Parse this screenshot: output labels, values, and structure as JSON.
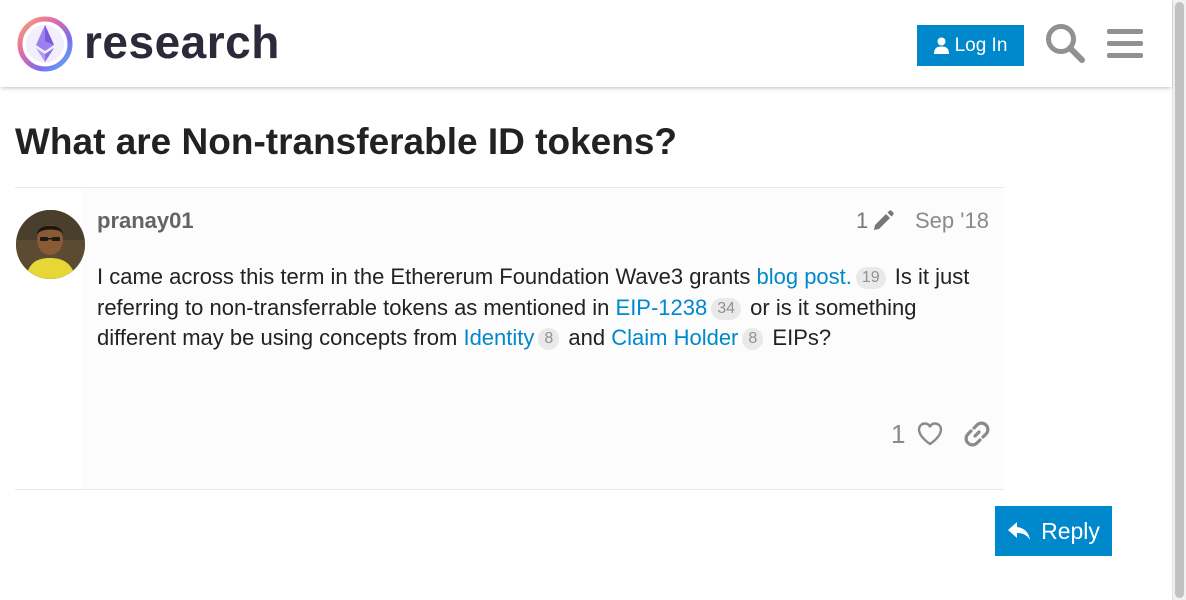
{
  "header": {
    "site_name": "research",
    "logo_icon": "ethereum-research-logo",
    "login_label": "Log In",
    "login_icon": "user-icon",
    "search_icon": "search-icon",
    "menu_icon": "hamburger-menu-icon"
  },
  "topic": {
    "title": "What are Non-transferable ID tokens?"
  },
  "post": {
    "username": "pranay01",
    "edit_count": "1",
    "date": "Sep '18",
    "segments": {
      "t1": "I came across this term in the Ethererum Foundation Wave3 grants ",
      "link1": "blog post.",
      "badge1": "19",
      "t2": " Is it just referring to non-transferrable tokens as mentioned in ",
      "link2": "EIP-1238",
      "badge2": "34",
      "t3": " or is it something different may be using concepts from ",
      "link3": "Identity",
      "badge3": "8",
      "t4": " and ",
      "link4": "Claim Holder",
      "badge4": "8",
      "t5": " EIPs?"
    },
    "like_count": "1"
  },
  "actions": {
    "reply_label": "Reply"
  },
  "colors": {
    "accent": "#0088cc",
    "text": "#222222",
    "muted": "#8a8a8a"
  }
}
